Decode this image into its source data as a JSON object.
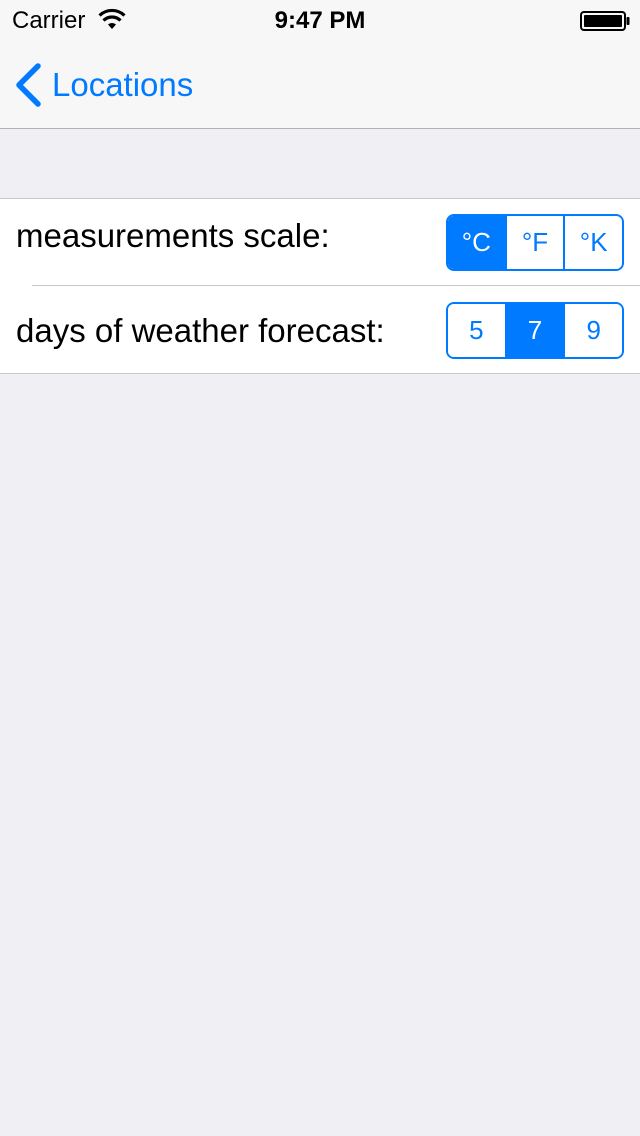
{
  "status_bar": {
    "carrier": "Carrier",
    "time": "9:47 PM"
  },
  "nav": {
    "back_label": "Locations"
  },
  "settings": {
    "measurement": {
      "label": "measurements scale:",
      "options": [
        "°C",
        "°F",
        "°K"
      ],
      "selected": "°C"
    },
    "forecast": {
      "label": "days of weather forecast:",
      "options": [
        "5",
        "7",
        "9"
      ],
      "selected": "7"
    }
  },
  "colors": {
    "accent": "#007aff",
    "background": "#efeff4"
  }
}
